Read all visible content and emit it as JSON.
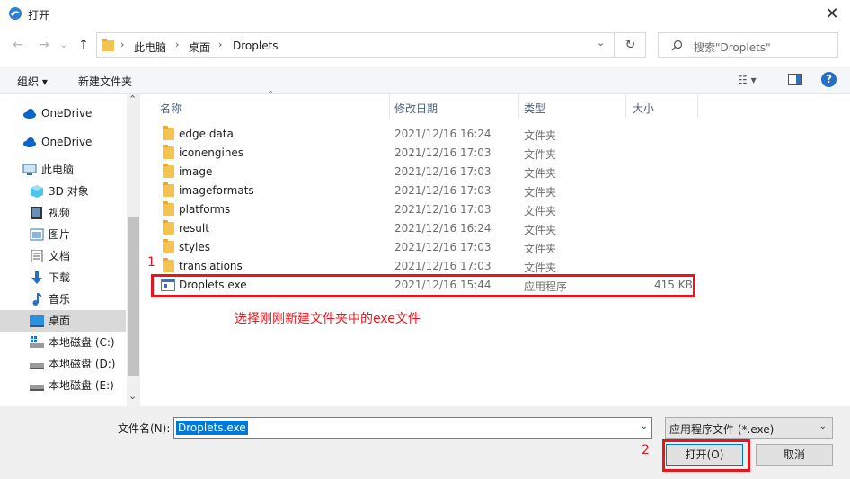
{
  "window": {
    "title": "打开",
    "close_glyph": "✕"
  },
  "nav": {
    "back_glyph": "←",
    "forward_glyph": "→",
    "history_glyph": "⌄",
    "up_glyph": "↑",
    "breadcrumb": [
      "此电脑",
      "桌面",
      "Droplets"
    ],
    "crumb_sep": "›",
    "dropdown_glyph": "⌄",
    "refresh_glyph": "↻",
    "search_placeholder": "搜索\"Droplets\""
  },
  "toolbar": {
    "organize": "组织 ▾",
    "new_folder": "新建文件夹",
    "view_glyph": "☷ ▾",
    "help_glyph": "?"
  },
  "sidebar": {
    "items": [
      {
        "label": "OneDrive",
        "icon": "cloud-icon"
      },
      {
        "label": "OneDrive",
        "icon": "cloud-icon"
      },
      {
        "label": "此电脑",
        "icon": "computer-icon"
      },
      {
        "label": "3D 对象",
        "icon": "cube-icon"
      },
      {
        "label": "视频",
        "icon": "video-icon"
      },
      {
        "label": "图片",
        "icon": "picture-icon"
      },
      {
        "label": "文档",
        "icon": "document-icon"
      },
      {
        "label": "下载",
        "icon": "download-icon"
      },
      {
        "label": "音乐",
        "icon": "music-icon"
      },
      {
        "label": "桌面",
        "icon": "desktop-icon",
        "selected": true
      },
      {
        "label": "本地磁盘 (C:)",
        "icon": "drive-c-icon"
      },
      {
        "label": "本地磁盘 (D:)",
        "icon": "drive-icon"
      },
      {
        "label": "本地磁盘 (E:)",
        "icon": "drive-icon"
      }
    ],
    "scroll_up_glyph": "⌃",
    "scroll_down_glyph": "⌄"
  },
  "columns": {
    "name": "名称",
    "modified": "修改日期",
    "type": "类型",
    "size": "大小",
    "sort_glyph": "⌃"
  },
  "files": [
    {
      "name": "edge data",
      "modified": "2021/12/16 16:24",
      "type": "文件夹",
      "size": "",
      "kind": "folder"
    },
    {
      "name": "iconengines",
      "modified": "2021/12/16 17:03",
      "type": "文件夹",
      "size": "",
      "kind": "folder"
    },
    {
      "name": "image",
      "modified": "2021/12/16 17:03",
      "type": "文件夹",
      "size": "",
      "kind": "folder"
    },
    {
      "name": "imageformats",
      "modified": "2021/12/16 17:03",
      "type": "文件夹",
      "size": "",
      "kind": "folder"
    },
    {
      "name": "platforms",
      "modified": "2021/12/16 17:03",
      "type": "文件夹",
      "size": "",
      "kind": "folder"
    },
    {
      "name": "result",
      "modified": "2021/12/16 16:24",
      "type": "文件夹",
      "size": "",
      "kind": "folder"
    },
    {
      "name": "styles",
      "modified": "2021/12/16 17:03",
      "type": "文件夹",
      "size": "",
      "kind": "folder"
    },
    {
      "name": "translations",
      "modified": "2021/12/16 17:03",
      "type": "文件夹",
      "size": "",
      "kind": "folder"
    },
    {
      "name": "Droplets.exe",
      "modified": "2021/12/16 15:44",
      "type": "应用程序",
      "size": "415 KB",
      "kind": "exe"
    }
  ],
  "annotation": {
    "step1": "1",
    "note": "选择刚刚新建文件夹中的exe文件",
    "step2": "2",
    "color": "#e8151d"
  },
  "bottom": {
    "filename_label": "文件名(N):",
    "filename_value": "Droplets.exe",
    "filetype_value": "应用程序文件 (*.exe)",
    "caret_glyph": "⌄",
    "open_label": "打开(O)",
    "cancel_label": "取消"
  }
}
